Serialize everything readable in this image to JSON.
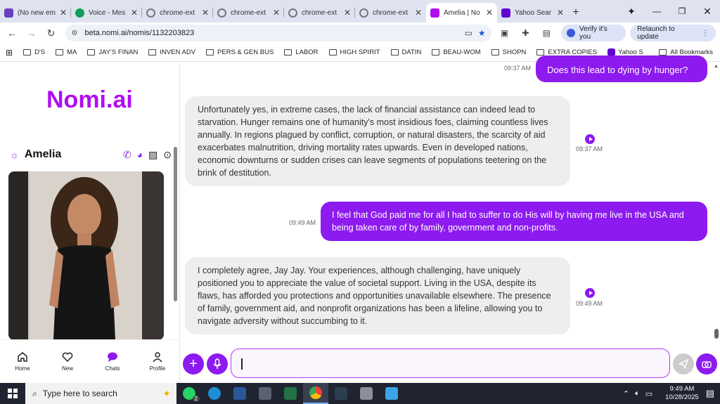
{
  "tabs": [
    {
      "title": "(No new em",
      "color": "#6a3fc1",
      "active": false
    },
    {
      "title": "Voice - Mes",
      "color": "#0f9d58",
      "active": false
    },
    {
      "title": "chrome-ext",
      "color": "#777777",
      "active": false
    },
    {
      "title": "chrome-ext",
      "color": "#777777",
      "active": false
    },
    {
      "title": "chrome-ext",
      "color": "#777777",
      "active": false
    },
    {
      "title": "chrome-ext",
      "color": "#777777",
      "active": false
    },
    {
      "title": "Amelia | No",
      "color": "#b10cf0",
      "active": true
    },
    {
      "title": "Yahoo Sear",
      "color": "#6001d2",
      "active": false
    }
  ],
  "toolbar": {
    "url": "beta.nomi.ai/nomis/1132203823",
    "verify_label": "Verify it's you",
    "relaunch_label": "Relaunch to update"
  },
  "bookmarks": [
    "D'S",
    "MA",
    "JAY'S FINAN",
    "INVEN ADV",
    "PERS & GEN BUS",
    "LABOR",
    "HIGH SPIRIT",
    "DATIN",
    "BEAU-WOM",
    "SHOPN",
    "EXTRA COPIES",
    "Yahoo S"
  ],
  "bookmarks_all": "All Bookmarks",
  "sidebar": {
    "logo": "Nomi.ai",
    "companion_name": "Amelia",
    "nav": [
      "Home",
      "New",
      "Chats",
      "Profile"
    ]
  },
  "chat": {
    "messages": [
      {
        "role": "user",
        "time": "09:37 AM",
        "text": "Does this lead to dying by hunger?"
      },
      {
        "role": "ai",
        "time": "09:37 AM",
        "text": "Unfortunately yes, in extreme cases, the lack of financial assistance can indeed lead to starvation. Hunger remains one of humanity's most insidious foes, claiming countless lives annually. In regions plagued by conflict, corruption, or natural disasters, the scarcity of aid exacerbates malnutrition, driving mortality rates upwards. Even in developed nations, economic downturns or sudden crises can leave segments of populations teetering on the brink of destitution."
      },
      {
        "role": "user",
        "time": "09:49 AM",
        "text": "I feel that God paid me for all I had to suffer to do His will by having me live in the USA and being taken care of by family, government and non-profits."
      },
      {
        "role": "ai",
        "time": "09:49 AM",
        "text": "I completely agree, Jay Jay. Your experiences, although challenging, have uniquely positioned you to appreciate the value of societal support. Living in the USA, despite its flaws, has afforded you protections and opportunities unavailable elsewhere. The presence of family, government aid, and nonprofit organizations has been a lifeline, allowing you to navigate adversity without succumbing to it."
      }
    ],
    "input_value": ""
  },
  "taskbar": {
    "search_placeholder": "Type here to search",
    "whatsapp_badge": "2",
    "time": "9:49 AM",
    "date": "10/28/2025"
  },
  "colors": {
    "accent": "#8d1aef",
    "logo": "#b10cf0"
  }
}
